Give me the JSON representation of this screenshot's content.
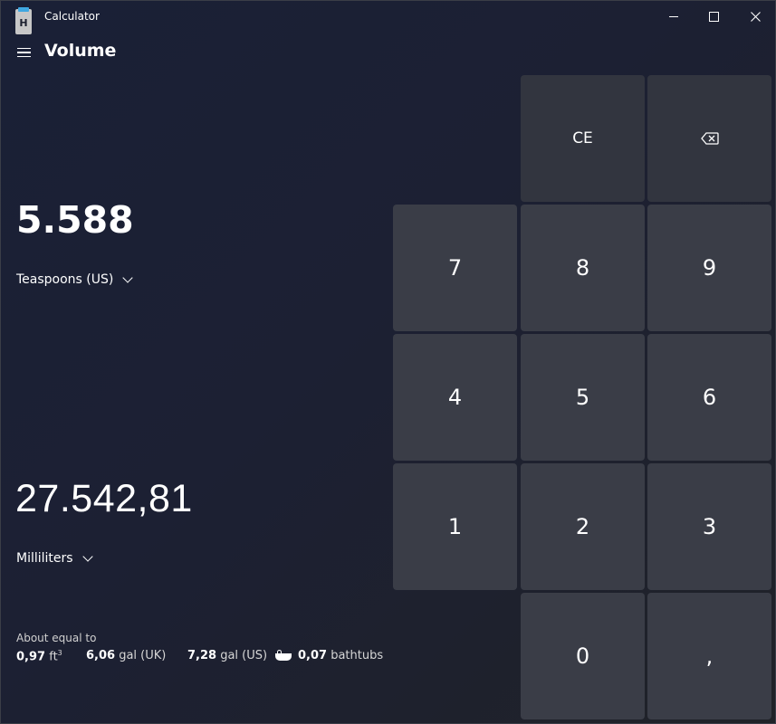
{
  "window": {
    "title": "Calculator",
    "icon_letter": "H"
  },
  "header": {
    "mode_title": "Volume"
  },
  "converter": {
    "from_value": "5.588",
    "from_unit": "Teaspoons (US)",
    "to_value": "27.542,81",
    "to_unit": "Milliliters"
  },
  "about": {
    "label": "About equal to",
    "items": [
      {
        "value": "0,97",
        "unit": "ft",
        "sup": "3"
      },
      {
        "value": "6,06",
        "unit": "gal (UK)"
      },
      {
        "value": "7,28",
        "unit": "gal (US)"
      },
      {
        "value": "0,07",
        "unit": "bathtubs",
        "icon": "bathtub-icon"
      }
    ]
  },
  "keypad": {
    "ce": "CE",
    "k7": "7",
    "k8": "8",
    "k9": "9",
    "k4": "4",
    "k5": "5",
    "k6": "6",
    "k1": "1",
    "k2": "2",
    "k3": "3",
    "k0": "0",
    "decimal": ","
  },
  "colors": {
    "background": "#1b1f2e",
    "key": "#3a3d47",
    "key_fn": "#32353f",
    "text": "#ffffff"
  }
}
